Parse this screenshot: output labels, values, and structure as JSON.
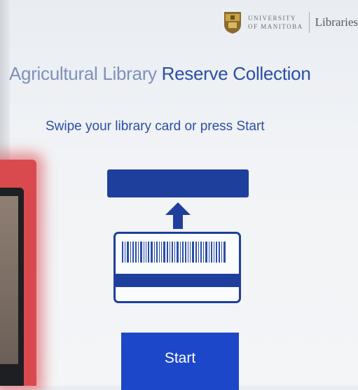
{
  "header": {
    "university_line1": "University",
    "university_line2": "of Manitoba",
    "libraries": "Libraries"
  },
  "main": {
    "title_part1": "Agricultural Library",
    "title_part2": " Reserve Collection",
    "instruction": "Swipe your library card or press Start",
    "start_label": "Start"
  },
  "icons": {
    "crest": "university-crest-icon",
    "arrow": "arrow-up-icon",
    "card_reader": "card-reader-slot-icon",
    "library_card": "library-card-icon"
  },
  "colors": {
    "primary_blue": "#1c47c9",
    "title_blue": "#2a4fa8",
    "card_blue": "#1f3f9e"
  }
}
